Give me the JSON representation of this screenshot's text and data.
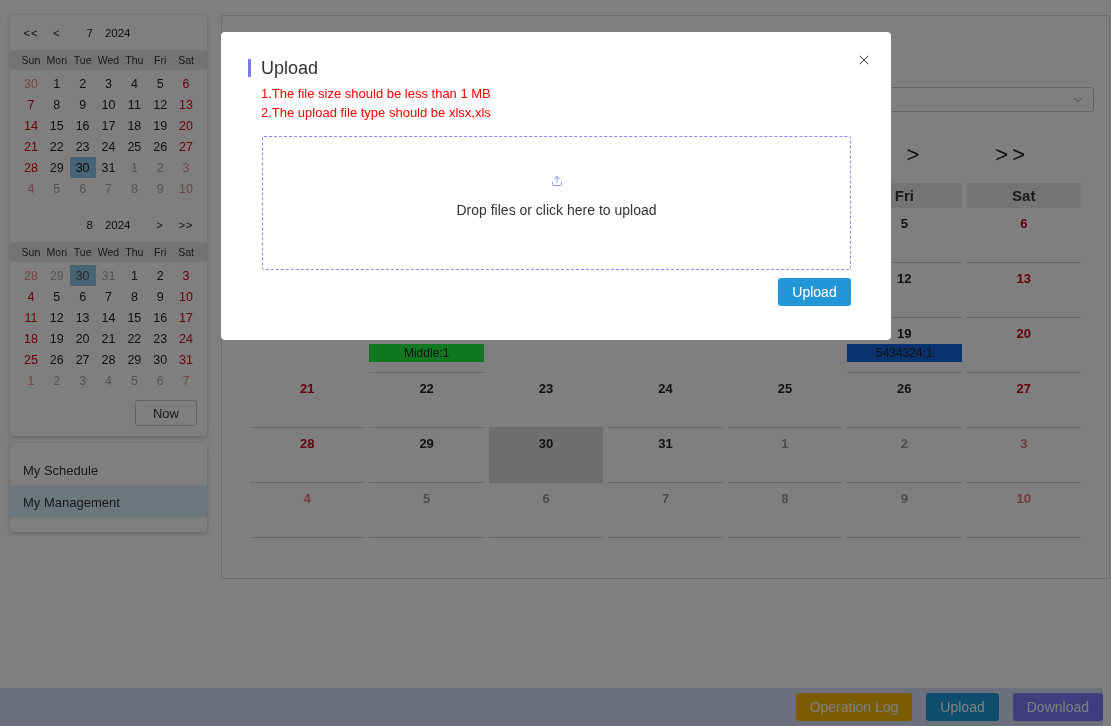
{
  "mini_calendars": [
    {
      "prev_nav": [
        "<<",
        "<"
      ],
      "month": "7",
      "year": "2024",
      "weekdays": [
        "Sun",
        "Mon",
        "Tue",
        "Wed",
        "Thu",
        "Fri",
        "Sat"
      ],
      "weeks": [
        [
          {
            "day": "30",
            "outside": true,
            "weekend": true,
            "selected": false
          },
          {
            "day": "1",
            "outside": false,
            "weekend": false,
            "selected": false
          },
          {
            "day": "2",
            "outside": false,
            "weekend": false,
            "selected": false
          },
          {
            "day": "3",
            "outside": false,
            "weekend": false,
            "selected": false
          },
          {
            "day": "4",
            "outside": false,
            "weekend": false,
            "selected": false
          },
          {
            "day": "5",
            "outside": false,
            "weekend": false,
            "selected": false
          },
          {
            "day": "6",
            "outside": false,
            "weekend": true,
            "selected": false
          }
        ],
        [
          {
            "day": "7",
            "outside": false,
            "weekend": true,
            "selected": false
          },
          {
            "day": "8",
            "outside": false,
            "weekend": false,
            "selected": false
          },
          {
            "day": "9",
            "outside": false,
            "weekend": false,
            "selected": false
          },
          {
            "day": "10",
            "outside": false,
            "weekend": false,
            "selected": false
          },
          {
            "day": "11",
            "outside": false,
            "weekend": false,
            "selected": false
          },
          {
            "day": "12",
            "outside": false,
            "weekend": false,
            "selected": false
          },
          {
            "day": "13",
            "outside": false,
            "weekend": true,
            "selected": false
          }
        ],
        [
          {
            "day": "14",
            "outside": false,
            "weekend": true,
            "selected": false
          },
          {
            "day": "15",
            "outside": false,
            "weekend": false,
            "selected": false
          },
          {
            "day": "16",
            "outside": false,
            "weekend": false,
            "selected": false
          },
          {
            "day": "17",
            "outside": false,
            "weekend": false,
            "selected": false
          },
          {
            "day": "18",
            "outside": false,
            "weekend": false,
            "selected": false
          },
          {
            "day": "19",
            "outside": false,
            "weekend": false,
            "selected": false
          },
          {
            "day": "20",
            "outside": false,
            "weekend": true,
            "selected": false
          }
        ],
        [
          {
            "day": "21",
            "outside": false,
            "weekend": true,
            "selected": false
          },
          {
            "day": "22",
            "outside": false,
            "weekend": false,
            "selected": false
          },
          {
            "day": "23",
            "outside": false,
            "weekend": false,
            "selected": false
          },
          {
            "day": "24",
            "outside": false,
            "weekend": false,
            "selected": false
          },
          {
            "day": "25",
            "outside": false,
            "weekend": false,
            "selected": false
          },
          {
            "day": "26",
            "outside": false,
            "weekend": false,
            "selected": false
          },
          {
            "day": "27",
            "outside": false,
            "weekend": true,
            "selected": false
          }
        ],
        [
          {
            "day": "28",
            "outside": false,
            "weekend": true,
            "selected": false
          },
          {
            "day": "29",
            "outside": false,
            "weekend": false,
            "selected": false
          },
          {
            "day": "30",
            "outside": false,
            "weekend": false,
            "selected": true
          },
          {
            "day": "31",
            "outside": false,
            "weekend": false,
            "selected": false
          },
          {
            "day": "1",
            "outside": true,
            "weekend": false,
            "selected": false
          },
          {
            "day": "2",
            "outside": true,
            "weekend": false,
            "selected": false
          },
          {
            "day": "3",
            "outside": true,
            "weekend": true,
            "selected": false
          }
        ],
        [
          {
            "day": "4",
            "outside": true,
            "weekend": true,
            "selected": false
          },
          {
            "day": "5",
            "outside": true,
            "weekend": false,
            "selected": false
          },
          {
            "day": "6",
            "outside": true,
            "weekend": false,
            "selected": false
          },
          {
            "day": "7",
            "outside": true,
            "weekend": false,
            "selected": false
          },
          {
            "day": "8",
            "outside": true,
            "weekend": false,
            "selected": false
          },
          {
            "day": "9",
            "outside": true,
            "weekend": false,
            "selected": false
          },
          {
            "day": "10",
            "outside": true,
            "weekend": true,
            "selected": false
          }
        ]
      ]
    },
    {
      "next_nav": [
        ">",
        ">>"
      ],
      "month": "8",
      "year": "2024",
      "weekdays": [
        "Sun",
        "Mon",
        "Tue",
        "Wed",
        "Thu",
        "Fri",
        "Sat"
      ],
      "weeks": [
        [
          {
            "day": "28",
            "outside": true,
            "weekend": true,
            "selected": false
          },
          {
            "day": "29",
            "outside": true,
            "weekend": false,
            "selected": false
          },
          {
            "day": "30",
            "outside": true,
            "weekend": false,
            "selected": true
          },
          {
            "day": "31",
            "outside": true,
            "weekend": false,
            "selected": false
          },
          {
            "day": "1",
            "outside": false,
            "weekend": false,
            "selected": false
          },
          {
            "day": "2",
            "outside": false,
            "weekend": false,
            "selected": false
          },
          {
            "day": "3",
            "outside": false,
            "weekend": true,
            "selected": false
          }
        ],
        [
          {
            "day": "4",
            "outside": false,
            "weekend": true,
            "selected": false
          },
          {
            "day": "5",
            "outside": false,
            "weekend": false,
            "selected": false
          },
          {
            "day": "6",
            "outside": false,
            "weekend": false,
            "selected": false
          },
          {
            "day": "7",
            "outside": false,
            "weekend": false,
            "selected": false
          },
          {
            "day": "8",
            "outside": false,
            "weekend": false,
            "selected": false
          },
          {
            "day": "9",
            "outside": false,
            "weekend": false,
            "selected": false
          },
          {
            "day": "10",
            "outside": false,
            "weekend": true,
            "selected": false
          }
        ],
        [
          {
            "day": "11",
            "outside": false,
            "weekend": true,
            "selected": false
          },
          {
            "day": "12",
            "outside": false,
            "weekend": false,
            "selected": false
          },
          {
            "day": "13",
            "outside": false,
            "weekend": false,
            "selected": false
          },
          {
            "day": "14",
            "outside": false,
            "weekend": false,
            "selected": false
          },
          {
            "day": "15",
            "outside": false,
            "weekend": false,
            "selected": false
          },
          {
            "day": "16",
            "outside": false,
            "weekend": false,
            "selected": false
          },
          {
            "day": "17",
            "outside": false,
            "weekend": true,
            "selected": false
          }
        ],
        [
          {
            "day": "18",
            "outside": false,
            "weekend": true,
            "selected": false
          },
          {
            "day": "19",
            "outside": false,
            "weekend": false,
            "selected": false
          },
          {
            "day": "20",
            "outside": false,
            "weekend": false,
            "selected": false
          },
          {
            "day": "21",
            "outside": false,
            "weekend": false,
            "selected": false
          },
          {
            "day": "22",
            "outside": false,
            "weekend": false,
            "selected": false
          },
          {
            "day": "23",
            "outside": false,
            "weekend": false,
            "selected": false
          },
          {
            "day": "24",
            "outside": false,
            "weekend": true,
            "selected": false
          }
        ],
        [
          {
            "day": "25",
            "outside": false,
            "weekend": true,
            "selected": false
          },
          {
            "day": "26",
            "outside": false,
            "weekend": false,
            "selected": false
          },
          {
            "day": "27",
            "outside": false,
            "weekend": false,
            "selected": false
          },
          {
            "day": "28",
            "outside": false,
            "weekend": false,
            "selected": false
          },
          {
            "day": "29",
            "outside": false,
            "weekend": false,
            "selected": false
          },
          {
            "day": "30",
            "outside": false,
            "weekend": false,
            "selected": false
          },
          {
            "day": "31",
            "outside": false,
            "weekend": true,
            "selected": false
          }
        ],
        [
          {
            "day": "1",
            "outside": true,
            "weekend": true,
            "selected": false
          },
          {
            "day": "2",
            "outside": true,
            "weekend": false,
            "selected": false
          },
          {
            "day": "3",
            "outside": true,
            "weekend": false,
            "selected": false
          },
          {
            "day": "4",
            "outside": true,
            "weekend": false,
            "selected": false
          },
          {
            "day": "5",
            "outside": true,
            "weekend": false,
            "selected": false
          },
          {
            "day": "6",
            "outside": true,
            "weekend": false,
            "selected": false
          },
          {
            "day": "7",
            "outside": true,
            "weekend": true,
            "selected": false
          }
        ]
      ]
    }
  ],
  "now_button": "Now",
  "menu": [
    {
      "label": "My Schedule",
      "selected": false
    },
    {
      "label": "My Management",
      "selected": true
    }
  ],
  "calendar": {
    "nav": [
      ">",
      ">>"
    ],
    "columns": [
      {
        "cells": [
          {
            "day": "21",
            "outside": false,
            "weekend": true,
            "selected": false
          },
          {
            "day": "28",
            "outside": false,
            "weekend": true,
            "selected": false
          },
          {
            "day": "4",
            "outside": true,
            "weekend": true,
            "selected": false
          }
        ]
      },
      {
        "cells": [
          {
            "events": [
              {
                "label": "Middle:1",
                "color": "#107820"
              }
            ]
          },
          {
            "day": "22",
            "outside": false,
            "weekend": false,
            "selected": false
          },
          {
            "day": "29",
            "outside": false,
            "weekend": false,
            "selected": false
          },
          {
            "day": "5",
            "outside": true,
            "weekend": false,
            "selected": false
          }
        ]
      },
      {
        "cells": [
          {
            "day": "23",
            "outside": false,
            "weekend": false,
            "selected": false
          },
          {
            "day": "30",
            "outside": false,
            "weekend": false,
            "selected": true
          },
          {
            "day": "6",
            "outside": true,
            "weekend": false,
            "selected": false
          }
        ]
      },
      {
        "cells": [
          {
            "day": "24",
            "outside": false,
            "weekend": false,
            "selected": false
          },
          {
            "day": "31",
            "outside": false,
            "weekend": false,
            "selected": false
          },
          {
            "day": "7",
            "outside": true,
            "weekend": false,
            "selected": false
          }
        ]
      },
      {
        "cells": [
          {
            "day": "25",
            "outside": false,
            "weekend": false,
            "selected": false
          },
          {
            "day": "1",
            "outside": true,
            "weekend": false,
            "selected": false
          },
          {
            "day": "8",
            "outside": true,
            "weekend": false,
            "selected": false
          }
        ]
      },
      {
        "header": "Fri",
        "cells": [
          {
            "day": "5",
            "outside": false,
            "weekend": false,
            "selected": false
          },
          {
            "day": "12",
            "outside": false,
            "weekend": false,
            "selected": false
          },
          {
            "day": "19",
            "outside": false,
            "weekend": false,
            "selected": false,
            "events": [
              {
                "label": "5434324:1",
                "color": "#0a326e"
              }
            ]
          },
          {
            "day": "26",
            "outside": false,
            "weekend": false,
            "selected": false
          },
          {
            "day": "2",
            "outside": true,
            "weekend": false,
            "selected": false
          },
          {
            "day": "9",
            "outside": true,
            "weekend": false,
            "selected": false
          }
        ]
      },
      {
        "header": "Sat",
        "cells": [
          {
            "day": "6",
            "outside": false,
            "weekend": true,
            "selected": false
          },
          {
            "day": "13",
            "outside": false,
            "weekend": true,
            "selected": false
          },
          {
            "day": "20",
            "outside": false,
            "weekend": true,
            "selected": false
          },
          {
            "day": "27",
            "outside": false,
            "weekend": true,
            "selected": false
          },
          {
            "day": "3",
            "outside": true,
            "weekend": true,
            "selected": false
          },
          {
            "day": "10",
            "outside": true,
            "weekend": true,
            "selected": false
          }
        ]
      }
    ]
  },
  "footer_buttons": [
    {
      "label": "Operation Log",
      "color": "#7b5d00"
    },
    {
      "label": "Upload",
      "color": "#0f4d6c"
    },
    {
      "label": "Download",
      "color": "#403c7d"
    }
  ],
  "modal": {
    "title": "Upload",
    "notes": [
      "1.The file size should be less than 1 MB",
      "2.The upload file type should be xlsx,xls"
    ],
    "dropzone_text": "Drop files or click here to upload",
    "button": "Upload"
  }
}
